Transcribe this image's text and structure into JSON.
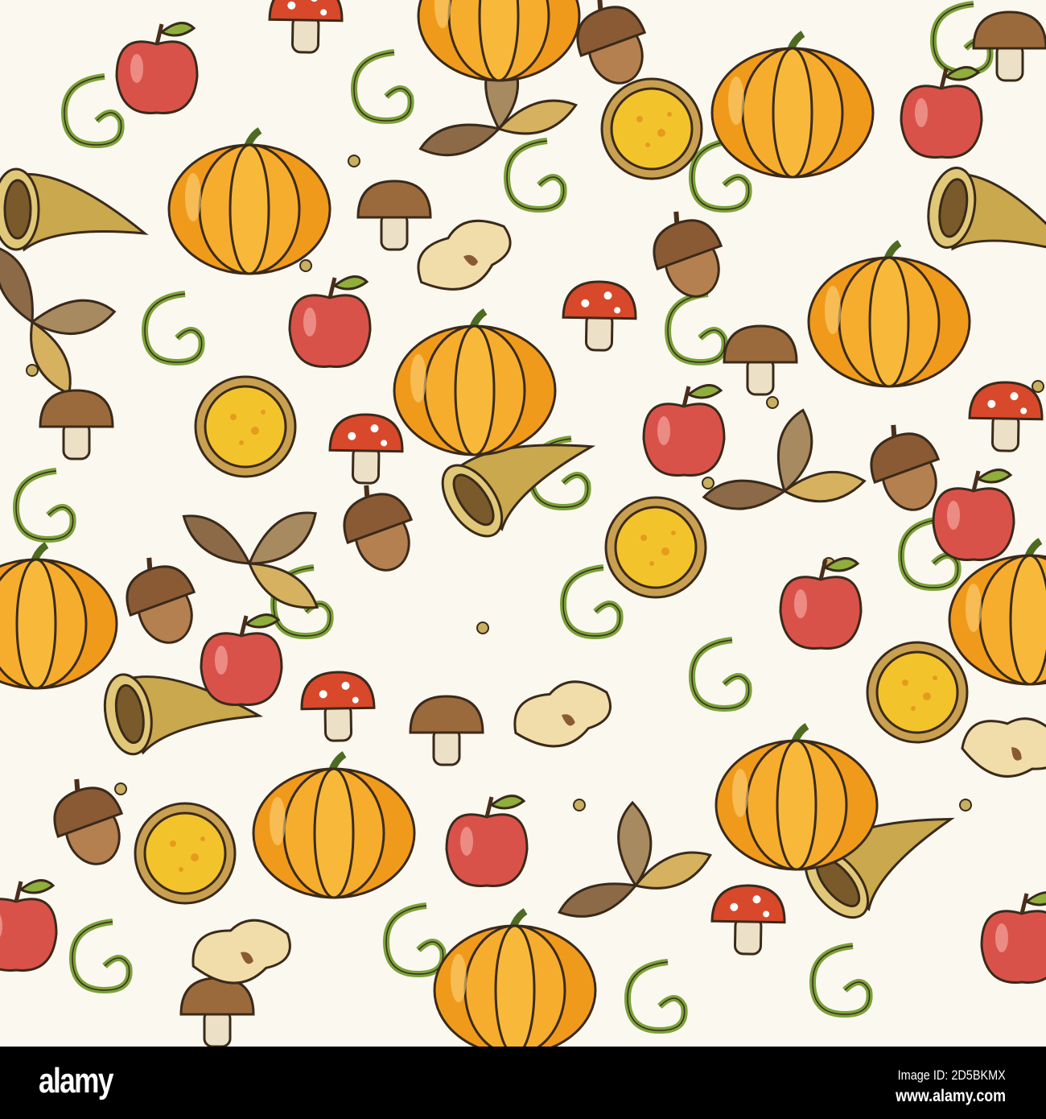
{
  "illustration": {
    "subject": "Autumn harvest seamless doodle pattern",
    "colors": {
      "background": "#fbf8f0",
      "pumpkin": "#f09a1c",
      "apple": "#d9524a",
      "pie": "#f3c32c",
      "acorn": "#8a5a34",
      "mushroom_cap": "#d8482a",
      "cornucopia": "#c9a84e",
      "leaf": "#8c6a48",
      "vine": "#7aa23a"
    }
  },
  "footer": {
    "logo": "alamy",
    "image_id": "Image ID: 2D5BKMX",
    "website": "www.alamy.com"
  }
}
